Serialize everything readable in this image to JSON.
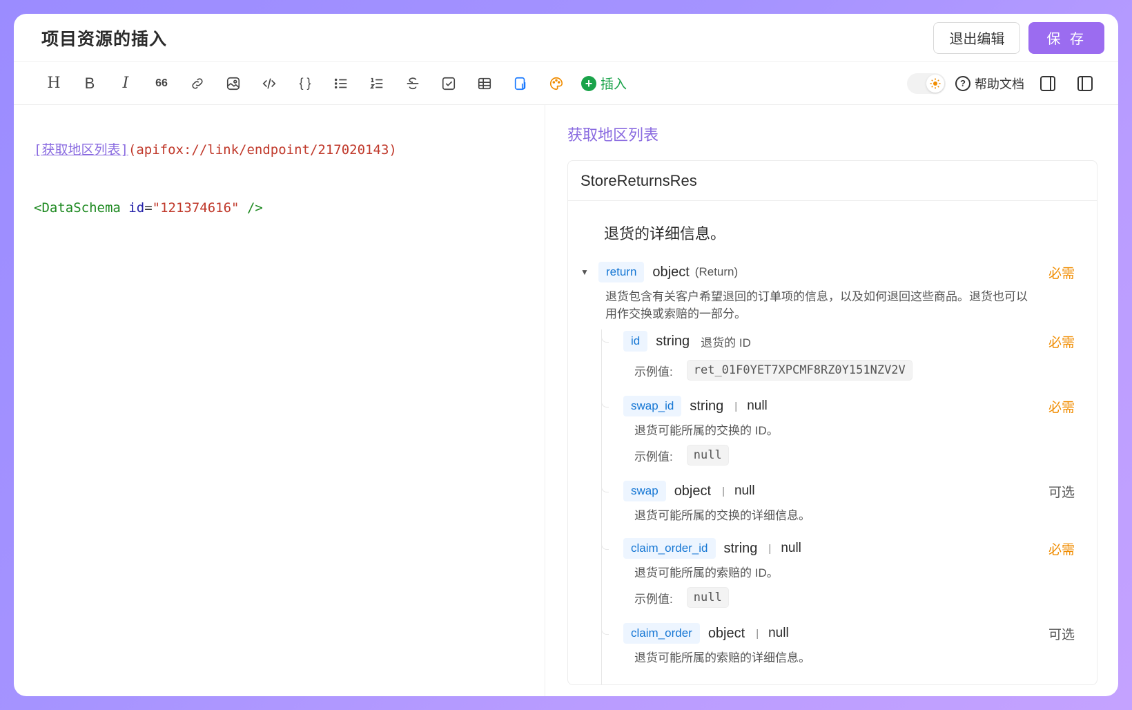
{
  "header": {
    "title": "项目资源的插入",
    "exit_label": "退出编辑",
    "save_label": "保 存"
  },
  "toolbar": {
    "heading": "H",
    "bold": "B",
    "italic": "I",
    "quote": "66",
    "braces": "{ }",
    "insert_label": "插入",
    "help_label": "帮助文档",
    "icons": [
      "heading-icon",
      "bold-icon",
      "italic-icon",
      "quote-icon",
      "link-icon",
      "image-icon",
      "code-icon",
      "code-block-icon",
      "bullet-list-icon",
      "ordered-list-icon",
      "strikethrough-icon",
      "task-list-icon",
      "table-icon",
      "attachment-icon",
      "palette-icon"
    ]
  },
  "editor": {
    "line1": {
      "link_text": "[获取地区列表]",
      "link_url": "(apifox://link/endpoint/217020143)"
    },
    "line2": {
      "open": "<DataSchema",
      "attr": "id",
      "eq": "=",
      "value": "\"121374616\"",
      "close": "/>"
    }
  },
  "preview": {
    "link": "获取地区列表",
    "schema": {
      "title": "StoreReturnsRes",
      "description": "退货的详细信息。",
      "root": {
        "name": "return",
        "type": "object",
        "ref": "(Return)",
        "required": "必需",
        "description": "退货包含有关客户希望退回的订单项的信息，以及如何退回这些商品。退货也可以用作交换或索赔的一部分。"
      },
      "example_label": "示例值:",
      "children": [
        {
          "name": "id",
          "type": "string",
          "nullable": "",
          "inline_desc": "退货的 ID",
          "flag": "必需",
          "desc": "",
          "example": "ret_01F0YET7XPCMF8RZ0Y151NZV2V"
        },
        {
          "name": "swap_id",
          "type": "string",
          "nullable": "null",
          "inline_desc": "",
          "flag": "必需",
          "desc": "退货可能所属的交换的 ID。",
          "example": "null"
        },
        {
          "name": "swap",
          "type": "object",
          "nullable": "null",
          "inline_desc": "",
          "flag": "可选",
          "desc": "退货可能所属的交换的详细信息。",
          "example": ""
        },
        {
          "name": "claim_order_id",
          "type": "string",
          "nullable": "null",
          "inline_desc": "",
          "flag": "必需",
          "desc": "退货可能所属的索赔的 ID。",
          "example": "null"
        },
        {
          "name": "claim_order",
          "type": "object",
          "nullable": "null",
          "inline_desc": "",
          "flag": "可选",
          "desc": "退货可能所属的索赔的详细信息。",
          "example": ""
        }
      ]
    }
  },
  "colors": {
    "accent": "#9b6cf0",
    "link": "#8a6be0",
    "required": "#f08c00",
    "prop_name": "#1677d4",
    "insert": "#1aa34a"
  }
}
